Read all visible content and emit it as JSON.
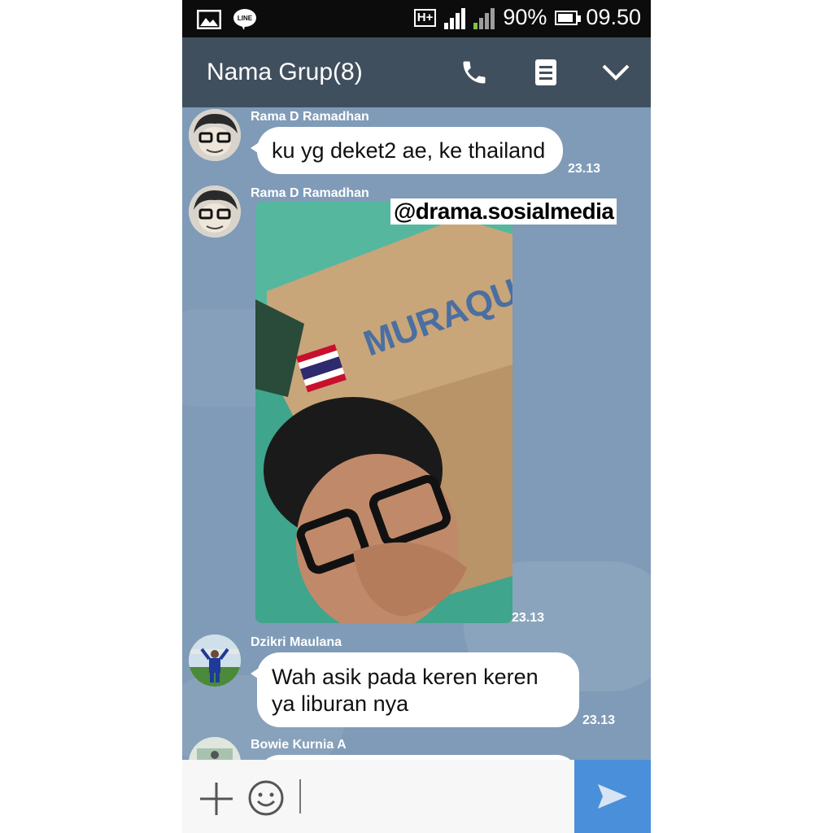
{
  "status_bar": {
    "network": "H+",
    "sim1": "1",
    "sim2": "2",
    "battery": "90%",
    "battery_level": 0.9,
    "time": "09.50"
  },
  "header": {
    "title": "Nama Grup(8)"
  },
  "watermark": "@drama.sosialmedia",
  "messages": [
    {
      "sender": "Rama D Ramadhan",
      "text": "ku yg deket2 ae, ke thailand",
      "time": "23.13"
    },
    {
      "sender": "Rama D Ramadhan",
      "type": "photo",
      "photo_text": "MURAQUA",
      "time": "23.13"
    },
    {
      "sender": "Dzikri Maulana",
      "text_line1": "Wah asik pada keren keren",
      "text_line2": "ya liburan nya",
      "time": "23.13"
    },
    {
      "sender": "Bowie Kurnia A"
    }
  ],
  "colors": {
    "chat_bg": "#7f9bb7",
    "header_bg": "#404f5e",
    "send_button": "#4a8fd9"
  },
  "icons": [
    "gallery-icon",
    "line-app-icon",
    "phone-icon",
    "notes-icon",
    "chevron-down-icon",
    "plus-icon",
    "emoji-icon",
    "send-icon"
  ]
}
